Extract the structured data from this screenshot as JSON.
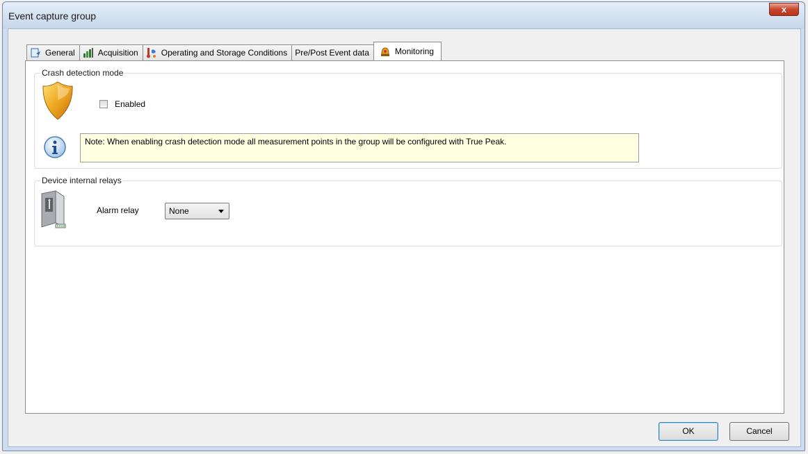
{
  "window": {
    "title": "Event capture group",
    "close_label": "x"
  },
  "tabs": [
    {
      "label": "General",
      "icon": "general-icon"
    },
    {
      "label": "Acquisition",
      "icon": "acquisition-icon"
    },
    {
      "label": "Operating and Storage Conditions",
      "icon": "conditions-icon"
    },
    {
      "label": "Pre/Post Event data",
      "icon": ""
    },
    {
      "label": "Monitoring",
      "icon": "monitoring-icon",
      "active": true
    }
  ],
  "crash_detection": {
    "legend": "Crash detection mode",
    "enabled_label": "Enabled",
    "enabled_checked": false,
    "note": "Note: When enabling crash detection mode all measurement points in the group will be configured with True Peak."
  },
  "relays": {
    "legend": "Device internal relays",
    "alarm_label": "Alarm relay",
    "alarm_value": "None"
  },
  "buttons": {
    "ok": "OK",
    "cancel": "Cancel"
  },
  "colors": {
    "note_background": "#ffffe1",
    "close_button": "#c7452c",
    "shield": "#f0a820"
  }
}
